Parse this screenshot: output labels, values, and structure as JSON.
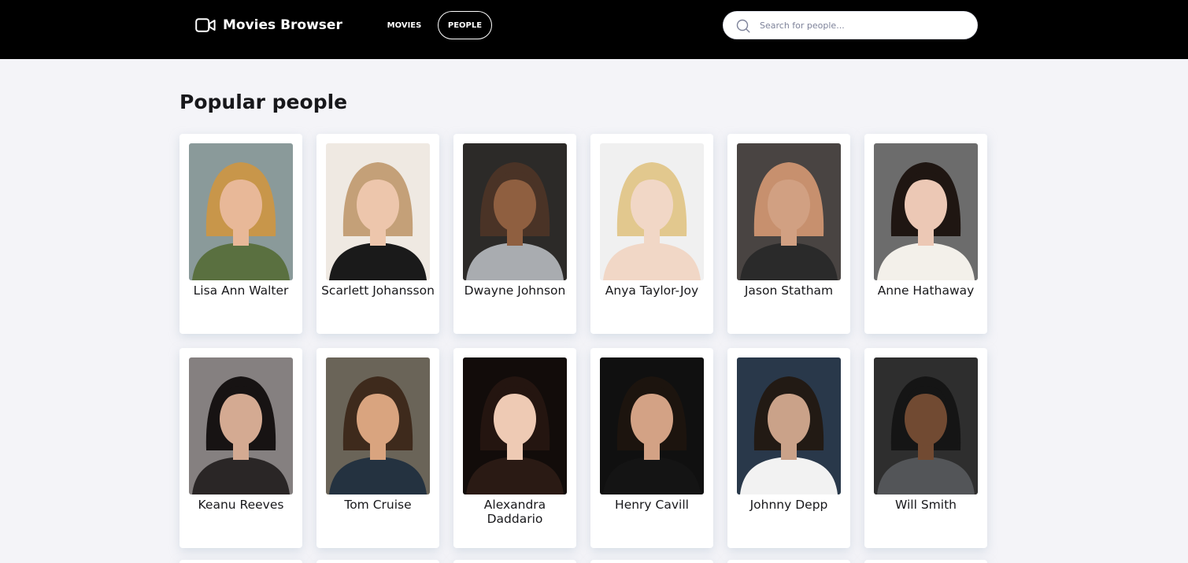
{
  "header": {
    "brand": "Movies Browser",
    "brand_icon": "video-camera-icon",
    "nav": {
      "movies": "MOVIES",
      "people": "PEOPLE",
      "active": "people"
    },
    "search": {
      "placeholder": "Search for people...",
      "value": "",
      "icon": "search-icon"
    }
  },
  "colors": {
    "topbar": "#000000",
    "page_bg": "#f4f4f8",
    "card_bg": "#ffffff",
    "text": "#18181b"
  },
  "main": {
    "title": "Popular people",
    "people": [
      {
        "name": "Lisa Ann Walter",
        "photo": {
          "bg": "#8a9a9a",
          "hair": "#c8964a",
          "skin": "#e8b898",
          "shirt": "#5a7040"
        }
      },
      {
        "name": "Scarlett Johansson",
        "photo": {
          "bg": "#efe9e2",
          "hair": "#c4a078",
          "skin": "#edc6ac",
          "shirt": "#1a1a1a"
        }
      },
      {
        "name": "Dwayne Johnson",
        "photo": {
          "bg": "#2c2a28",
          "hair": "#4a3326",
          "skin": "#8f5f40",
          "shirt": "#a9acb0"
        }
      },
      {
        "name": "Anya Taylor-Joy",
        "photo": {
          "bg": "#f0f0f0",
          "hair": "#e2c88e",
          "skin": "#f1d7c6",
          "shirt": "#f1d7c6"
        }
      },
      {
        "name": "Jason Statham",
        "photo": {
          "bg": "#494442",
          "hair": "#c7906e",
          "skin": "#d1a082",
          "shirt": "#2a2a2a"
        }
      },
      {
        "name": "Anne Hathaway",
        "photo": {
          "bg": "#6c6c6c",
          "hair": "#1f1612",
          "skin": "#ecc8b5",
          "shirt": "#f3f0ea"
        }
      },
      {
        "name": "Keanu Reeves",
        "photo": {
          "bg": "#858080",
          "hair": "#171313",
          "skin": "#d4aa92",
          "shirt": "#2a2626"
        }
      },
      {
        "name": "Tom Cruise",
        "photo": {
          "bg": "#6a6458",
          "hair": "#3e2a1c",
          "skin": "#d9a47f",
          "shirt": "#243240"
        }
      },
      {
        "name": "Alexandra Daddario",
        "photo": {
          "bg": "#120c0a",
          "hair": "#241510",
          "skin": "#eecab4",
          "shirt": "#2a1a14"
        }
      },
      {
        "name": "Henry Cavill",
        "photo": {
          "bg": "#101010",
          "hair": "#1c140e",
          "skin": "#d3a285",
          "shirt": "#141414"
        }
      },
      {
        "name": "Johnny Depp",
        "photo": {
          "bg": "#29384a",
          "hair": "#221a14",
          "skin": "#caa289",
          "shirt": "#f2f2f2"
        }
      },
      {
        "name": "Will Smith",
        "photo": {
          "bg": "#2e2e2e",
          "hair": "#151515",
          "skin": "#714a32",
          "shirt": "#535558"
        }
      }
    ]
  }
}
